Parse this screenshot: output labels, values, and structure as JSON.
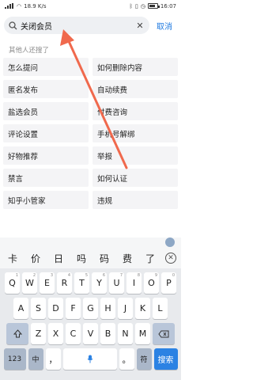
{
  "status": {
    "time": "16:07",
    "net": "18.9 K/s",
    "battery": ""
  },
  "search": {
    "value": "关闭会员",
    "placeholder": "",
    "cancel_label": "取消"
  },
  "section_title": "其他人还搜了",
  "suggestions": [
    [
      "怎么提问",
      "如何删除内容"
    ],
    [
      "匿名发布",
      "自动续费"
    ],
    [
      "盐选会员",
      "付费咨询"
    ],
    [
      "评论设置",
      "手机号解绑"
    ],
    [
      "好物推荐",
      "举报"
    ],
    [
      "禁言",
      "如何认证"
    ],
    [
      "知乎小管家",
      "违规"
    ]
  ],
  "keyboard": {
    "candidates": [
      "卡",
      "价",
      "日",
      "吗",
      "码",
      "费",
      "了"
    ],
    "row1": [
      "Q",
      "W",
      "E",
      "R",
      "T",
      "Y",
      "U",
      "I",
      "O",
      "P"
    ],
    "row1_sup": [
      "1",
      "2",
      "3",
      "4",
      "5",
      "6",
      "7",
      "8",
      "9",
      "0"
    ],
    "row2": [
      "A",
      "S",
      "D",
      "F",
      "G",
      "H",
      "J",
      "K",
      "L"
    ],
    "row3": [
      "Z",
      "X",
      "C",
      "V",
      "B",
      "N",
      "M"
    ],
    "numbers_key": "123",
    "lang_key": "中",
    "comma_key": "，",
    "period_key": "。",
    "symbol_key": "符",
    "search_key": "搜索"
  },
  "colors": {
    "accent": "#1f7ae0",
    "arrow": "#f0694d",
    "search_key": "#2b82e3"
  }
}
